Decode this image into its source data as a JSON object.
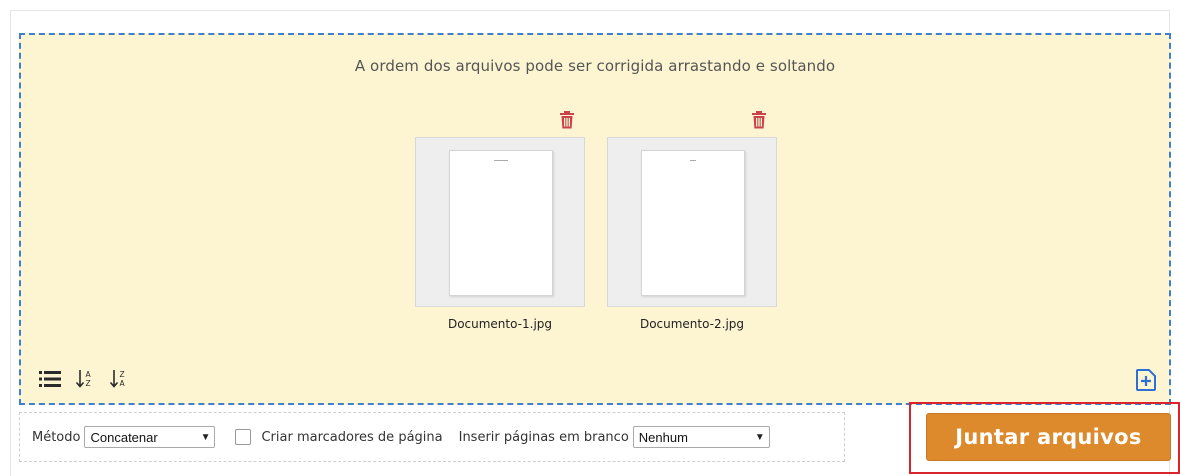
{
  "dropzone": {
    "hint": "A ordem dos arquivos pode ser corrigida arrastando e soltando",
    "files": [
      {
        "name": "Documento-1.jpg"
      },
      {
        "name": "Documento-2.jpg"
      }
    ],
    "tools": [
      "list-view-icon",
      "sort-a-z-icon",
      "sort-z-a-icon"
    ],
    "add_icon": "add-file-icon"
  },
  "options": {
    "method_label": "Método",
    "method_value": "Concatenar",
    "bookmarks_label": "Criar marcadores de página",
    "bookmarks_checked": false,
    "blank_pages_label": "Inserir páginas em branco",
    "blank_pages_value": "Nenhum"
  },
  "merge_button_label": "Juntar arquivos",
  "colors": {
    "dropzone_bg": "#fdf5d2",
    "dropzone_border": "#3f7fd0",
    "trash": "#c9444a",
    "button": "#dd8a2c",
    "highlight": "#d9232d"
  }
}
